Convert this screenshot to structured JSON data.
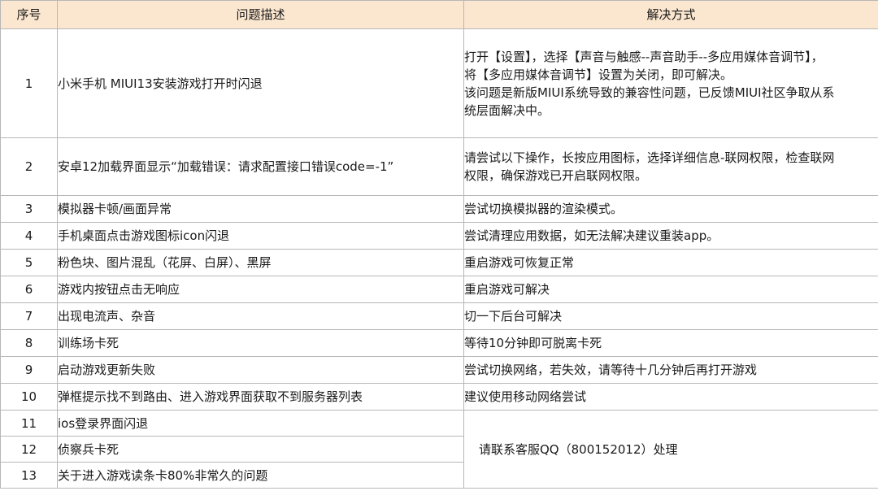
{
  "header": {
    "no": "序号",
    "desc": "问题描述",
    "sol": "解决方式"
  },
  "rows": [
    {
      "no": "1",
      "desc": "小米手机 MIUI13安装游戏打开时闪退",
      "sol": [
        "打开【设置】，选择【声音与触感--声音助手--多应用媒体音调节】，",
        "将【多应用媒体音调节】设置为关闭，即可解决。",
        "该问题是新版MIUI系统导致的兼容性问题，已反馈MIUI社区争取从系",
        "统层面解决中。"
      ]
    },
    {
      "no": "2",
      "desc": "安卓12加载界面显示“加载错误：请求配置接口错误code=-1”",
      "sol": [
        "请尝试以下操作，长按应用图标，选择详细信息-联网权限，检查联网",
        "权限，确保游戏已开启联网权限。"
      ]
    },
    {
      "no": "3",
      "desc": "模拟器卡顿/画面异常",
      "sol": [
        "尝试切换模拟器的渲染模式。"
      ]
    },
    {
      "no": "4",
      "desc": "手机桌面点击游戏图标icon闪退",
      "sol": [
        "尝试清理应用数据，如无法解决建议重装app。"
      ]
    },
    {
      "no": "5",
      "desc": "粉色块、图片混乱（花屏、白屏）、黑屏",
      "sol": [
        "重启游戏可恢复正常"
      ]
    },
    {
      "no": "6",
      "desc": "游戏内按钮点击无响应",
      "sol": [
        "重启游戏可解决"
      ]
    },
    {
      "no": "7",
      "desc": "出现电流声、杂音",
      "sol": [
        "切一下后台可解决"
      ]
    },
    {
      "no": "8",
      "desc": "训练场卡死",
      "sol": [
        "等待10分钟即可脱离卡死"
      ]
    },
    {
      "no": "9",
      "desc": "启动游戏更新失败",
      "sol": [
        "尝试切换网络，若失效，请等待十几分钟后再打开游戏"
      ]
    },
    {
      "no": "10",
      "desc": "弹框提示找不到路由、进入游戏界面获取不到服务器列表",
      "sol": [
        "建议使用移动网络尝试"
      ]
    },
    {
      "no": "11",
      "desc": "ios登录界面闪退"
    },
    {
      "no": "12",
      "desc": "侦察兵卡死"
    },
    {
      "no": "13",
      "desc": "关于进入游戏读条卡80%非常久的问题"
    }
  ],
  "merged_solution": "请联系客服QQ（800152012）处理"
}
